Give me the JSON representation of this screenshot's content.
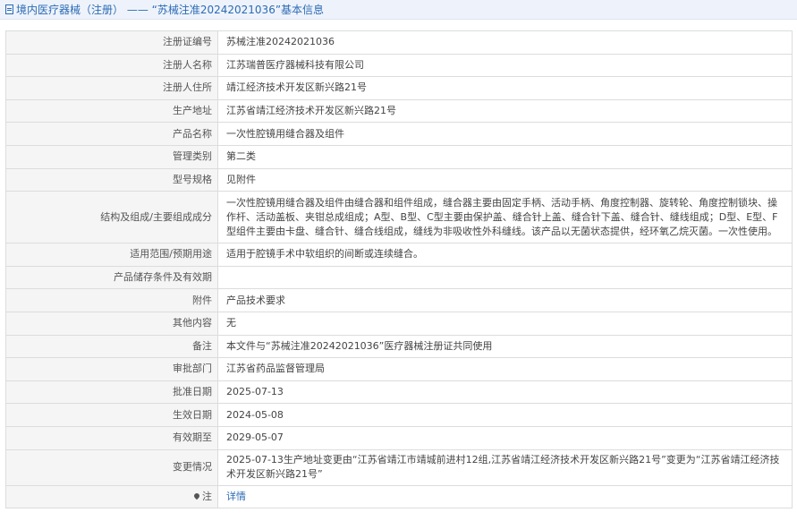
{
  "header": {
    "title": "境内医疗器械（注册） —— “苏械注准20242021036”基本信息"
  },
  "rows": [
    {
      "label": "注册证编号",
      "value": "苏械注准20242021036"
    },
    {
      "label": "注册人名称",
      "value": "江苏瑞普医疗器械科技有限公司"
    },
    {
      "label": "注册人住所",
      "value": "靖江经济技术开发区新兴路21号"
    },
    {
      "label": "生产地址",
      "value": "江苏省靖江经济技术开发区新兴路21号"
    },
    {
      "label": "产品名称",
      "value": "一次性腔镜用缝合器及组件"
    },
    {
      "label": "管理类别",
      "value": "第二类"
    },
    {
      "label": "型号规格",
      "value": "见附件"
    },
    {
      "label": "结构及组成/主要组成成分",
      "value": "一次性腔镜用缝合器及组件由缝合器和组件组成，缝合器主要由固定手柄、活动手柄、角度控制器、旋转轮、角度控制锁块、操作杆、活动盖板、夹钳总成组成；A型、B型、C型主要由保护盖、缝合针上盖、缝合针下盖、缝合针、缝线组成；D型、E型、F型组件主要由卡盘、缝合针、缝合线组成，缝线为非吸收性外科缝线。该产品以无菌状态提供，经环氧乙烷灭菌。一次性使用。"
    },
    {
      "label": "适用范围/预期用途",
      "value": "适用于腔镜手术中软组织的间断或连续缝合。"
    },
    {
      "label": "产品储存条件及有效期",
      "value": ""
    },
    {
      "label": "附件",
      "value": "产品技术要求"
    },
    {
      "label": "其他内容",
      "value": "无"
    },
    {
      "label": "备注",
      "value": "本文件与“苏械注准20242021036”医疗器械注册证共同使用"
    },
    {
      "label": "审批部门",
      "value": "江苏省药品监督管理局"
    },
    {
      "label": "批准日期",
      "value": "2025-07-13"
    },
    {
      "label": "生效日期",
      "value": "2024-05-08"
    },
    {
      "label": "有效期至",
      "value": "2029-05-07"
    },
    {
      "label": "变更情况",
      "value": "2025-07-13生产地址变更由“江苏省靖江市靖城前进村12组,江苏省靖江经济技术开发区新兴路21号”变更为“江苏省靖江经济技术开发区新兴路21号”"
    },
    {
      "label": "注",
      "value": "详情"
    }
  ],
  "icons": {
    "title": "document-icon",
    "note": "pin-icon"
  },
  "colors": {
    "accent": "#2c6bb5",
    "label_bg": "#f5f5f5",
    "border": "#dcdcdc"
  }
}
